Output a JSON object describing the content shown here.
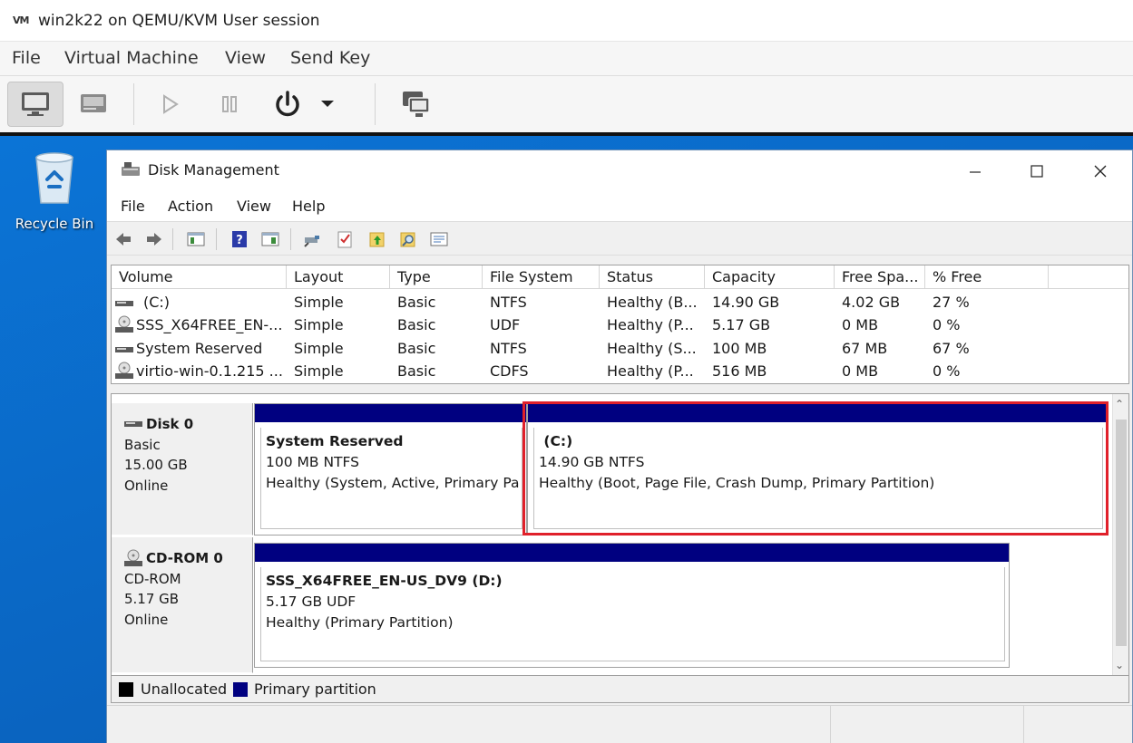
{
  "host": {
    "title": "win2k22 on QEMU/KVM User session",
    "menu": [
      "File",
      "Virtual Machine",
      "View",
      "Send Key"
    ]
  },
  "desktop": {
    "recycle_bin_label": "Recycle Bin"
  },
  "disk_management": {
    "title": "Disk Management",
    "menu": [
      "File",
      "Action",
      "View",
      "Help"
    ],
    "columns": [
      "Volume",
      "Layout",
      "Type",
      "File System",
      "Status",
      "Capacity",
      "Free Spa...",
      "% Free"
    ],
    "volumes": [
      {
        "volume": "(C:)",
        "layout": "Simple",
        "type": "Basic",
        "fs": "NTFS",
        "status": "Healthy (B...",
        "capacity": "14.90 GB",
        "free": "4.02 GB",
        "pct": "27 %",
        "icon": "drive-icon"
      },
      {
        "volume": "SSS_X64FREE_EN-...",
        "layout": "Simple",
        "type": "Basic",
        "fs": "UDF",
        "status": "Healthy (P...",
        "capacity": "5.17 GB",
        "free": "0 MB",
        "pct": "0 %",
        "icon": "cdrom-icon"
      },
      {
        "volume": "System Reserved",
        "layout": "Simple",
        "type": "Basic",
        "fs": "NTFS",
        "status": "Healthy (S...",
        "capacity": "100 MB",
        "free": "67 MB",
        "pct": "67 %",
        "icon": "drive-icon"
      },
      {
        "volume": "virtio-win-0.1.215 ...",
        "layout": "Simple",
        "type": "Basic",
        "fs": "CDFS",
        "status": "Healthy (P...",
        "capacity": "516 MB",
        "free": "0 MB",
        "pct": "0 %",
        "icon": "cdrom-icon"
      }
    ],
    "disks": [
      {
        "name": "Disk 0",
        "kind": "Basic",
        "size": "15.00 GB",
        "state": "Online",
        "partitions": [
          {
            "name": "System Reserved",
            "detail": "100 MB NTFS",
            "status": "Healthy (System, Active, Primary Pa"
          },
          {
            "name": "(C:)",
            "detail": "14.90 GB NTFS",
            "status": "Healthy (Boot, Page File, Crash Dump, Primary Partition)"
          }
        ]
      },
      {
        "name": "CD-ROM 0",
        "kind": "CD-ROM",
        "size": "5.17 GB",
        "state": "Online",
        "partitions": [
          {
            "name": "SSS_X64FREE_EN-US_DV9  (D:)",
            "detail": "5.17 GB UDF",
            "status": "Healthy (Primary Partition)"
          }
        ]
      }
    ],
    "legend": {
      "unallocated": "Unallocated",
      "primary": "Primary partition"
    },
    "colors": {
      "unallocated": "#000000",
      "primary": "#000080",
      "highlight": "#e0202a"
    }
  }
}
